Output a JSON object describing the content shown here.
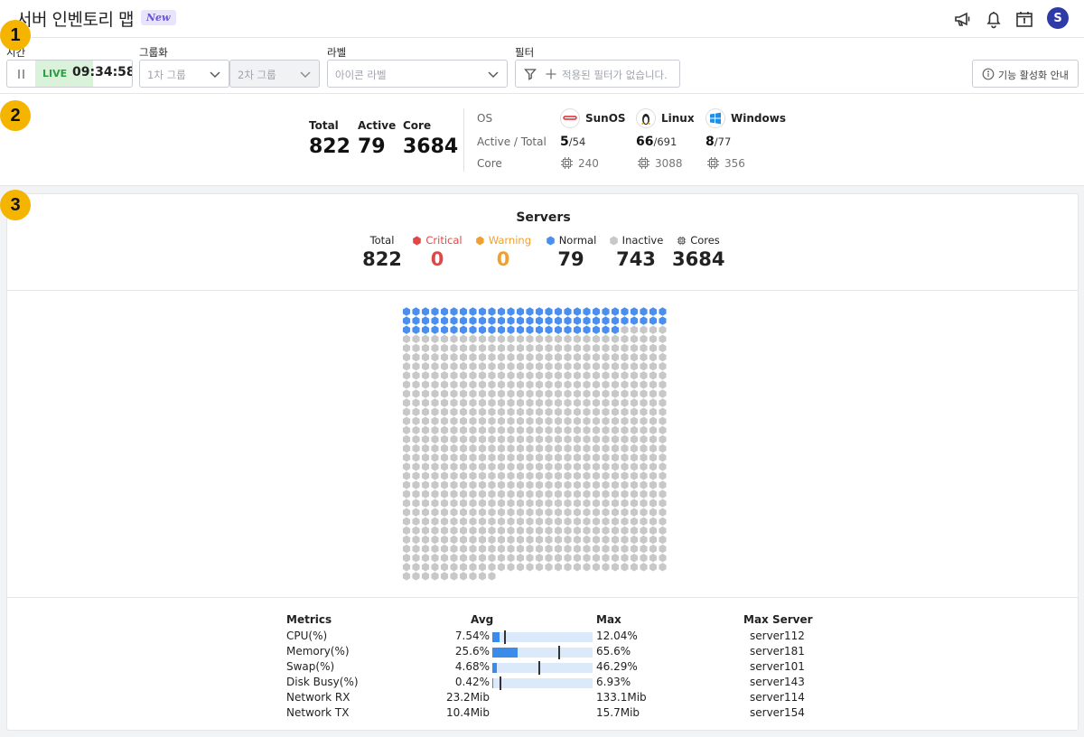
{
  "header": {
    "title": "서버 인벤토리 맵",
    "badge": "New",
    "avatar_initial": "S",
    "icons": [
      "megaphone-icon",
      "bell-icon",
      "calendar-icon"
    ]
  },
  "filters": {
    "time": {
      "label": "시간",
      "live": "LIVE",
      "clock": "09:34:58"
    },
    "group": {
      "label": "그룹화",
      "first_placeholder": "1차 그룹",
      "second_placeholder": "2차 그룹"
    },
    "label": {
      "label": "라벨",
      "placeholder": "아이콘 라벨"
    },
    "filter": {
      "label": "필터",
      "placeholder": "적용된 필터가 없습니다."
    },
    "help_button": "기능 활성화 안내"
  },
  "summary": {
    "total_label": "Total",
    "total": "822",
    "active_label": "Active",
    "active": "79",
    "core_label": "Core",
    "core": "3684",
    "os_label": "OS",
    "active_total_label": "Active / Total",
    "core_row_label": "Core",
    "os": [
      {
        "name": "SunOS",
        "active": "5",
        "total": "/54",
        "core": "240"
      },
      {
        "name": "Linux",
        "active": "66",
        "total": "/691",
        "core": "3088"
      },
      {
        "name": "Windows",
        "active": "8",
        "total": "/77",
        "core": "356"
      }
    ]
  },
  "servers": {
    "title": "Servers",
    "stats": [
      {
        "label": "Total",
        "value": "822",
        "color": "#222222"
      },
      {
        "label": "Critical",
        "value": "0",
        "color": "#e04848"
      },
      {
        "label": "Warning",
        "value": "0",
        "color": "#f0a030"
      },
      {
        "label": "Normal",
        "value": "79",
        "color": "#222222"
      },
      {
        "label": "Inactive",
        "value": "743",
        "color": "#222222"
      },
      {
        "label": "Cores",
        "value": "3684",
        "color": "#222222"
      }
    ],
    "colors": {
      "normal": "#4a8ff0",
      "inactive": "#c8c8c8",
      "critical": "#e04848",
      "warning": "#f0a030"
    },
    "hex_grid": {
      "total": 822,
      "normal": 79,
      "per_row": 28
    }
  },
  "metrics": {
    "headers": {
      "metrics": "Metrics",
      "avg": "Avg",
      "max": "Max",
      "max_server": "Max Server"
    },
    "rows": [
      {
        "name": "CPU(%)",
        "avg": "7.54%",
        "max": "12.04%",
        "server": "server112",
        "avg_pct": 7.54,
        "max_pct": 12.04,
        "bar": true
      },
      {
        "name": "Memory(%)",
        "avg": "25.6%",
        "max": "65.6%",
        "server": "server181",
        "avg_pct": 25.6,
        "max_pct": 65.6,
        "bar": true
      },
      {
        "name": "Swap(%)",
        "avg": "4.68%",
        "max": "46.29%",
        "server": "server101",
        "avg_pct": 4.68,
        "max_pct": 46.29,
        "bar": true
      },
      {
        "name": "Disk Busy(%)",
        "avg": "0.42%",
        "max": "6.93%",
        "server": "server143",
        "avg_pct": 0.42,
        "max_pct": 6.93,
        "bar": true
      },
      {
        "name": "Network RX",
        "avg": "23.2Mib",
        "max": "133.1Mib",
        "server": "server114",
        "bar": false
      },
      {
        "name": "Network TX",
        "avg": "10.4Mib",
        "max": "15.7Mib",
        "server": "server154",
        "bar": false
      }
    ]
  },
  "steps": [
    "1",
    "2",
    "3"
  ]
}
